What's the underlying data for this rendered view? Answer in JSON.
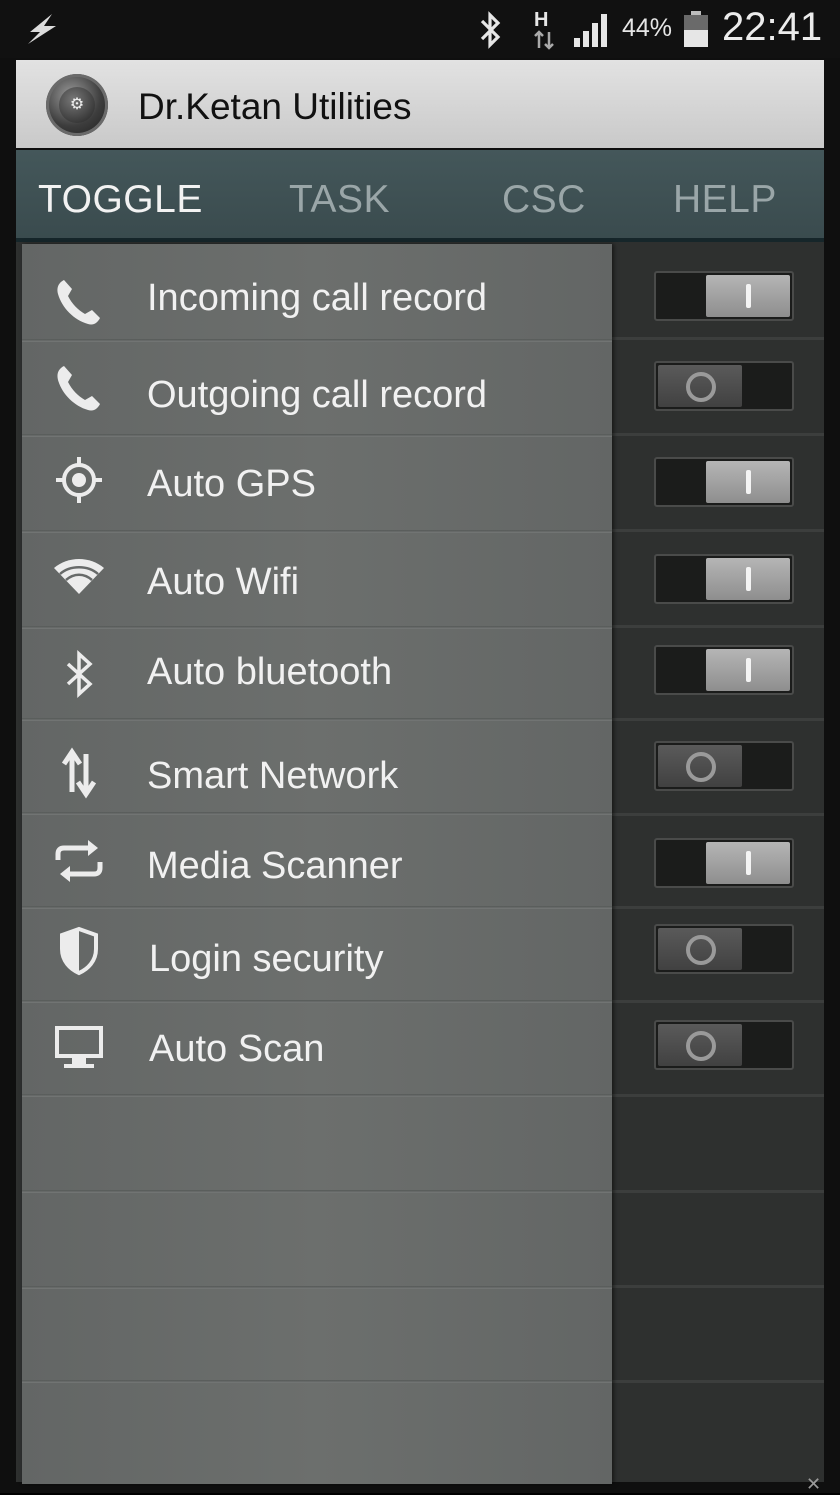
{
  "status_bar": {
    "battery_percent": "44%",
    "time": "22:41",
    "network_type": "H",
    "icons": [
      "flash-icon",
      "bluetooth-icon",
      "h-network-icon",
      "signal-icon",
      "battery-icon"
    ]
  },
  "app": {
    "title": "Dr.Ketan Utilities",
    "icon": "app-logo-icon"
  },
  "tabs": [
    {
      "label": "TOGGLE",
      "active": true
    },
    {
      "label": "TASK",
      "active": false
    },
    {
      "label": "CSC",
      "active": false
    },
    {
      "label": "HELP",
      "active": false
    }
  ],
  "toggles": [
    {
      "label": "Incoming call record",
      "icon": "phone-icon",
      "on": true
    },
    {
      "label": "Outgoing call record",
      "icon": "phone-icon",
      "on": false
    },
    {
      "label": "Auto GPS",
      "icon": "gps-icon",
      "on": true
    },
    {
      "label": "Auto Wifi",
      "icon": "wifi-icon",
      "on": true
    },
    {
      "label": "Auto bluetooth",
      "icon": "bluetooth-icon",
      "on": true
    },
    {
      "label": "Smart Network",
      "icon": "data-arrows-icon",
      "on": false
    },
    {
      "label": "Media Scanner",
      "icon": "sync-icon",
      "on": true
    },
    {
      "label": "Login security",
      "icon": "shield-icon",
      "on": false
    },
    {
      "label": "Auto Scan",
      "icon": "monitor-icon",
      "on": false
    }
  ],
  "colors": {
    "tab_bar": "#3f5154",
    "panel": "#676a69",
    "toggle_on_knob": "#a0a0a0",
    "toggle_off_knob": "#4d4d4d"
  }
}
